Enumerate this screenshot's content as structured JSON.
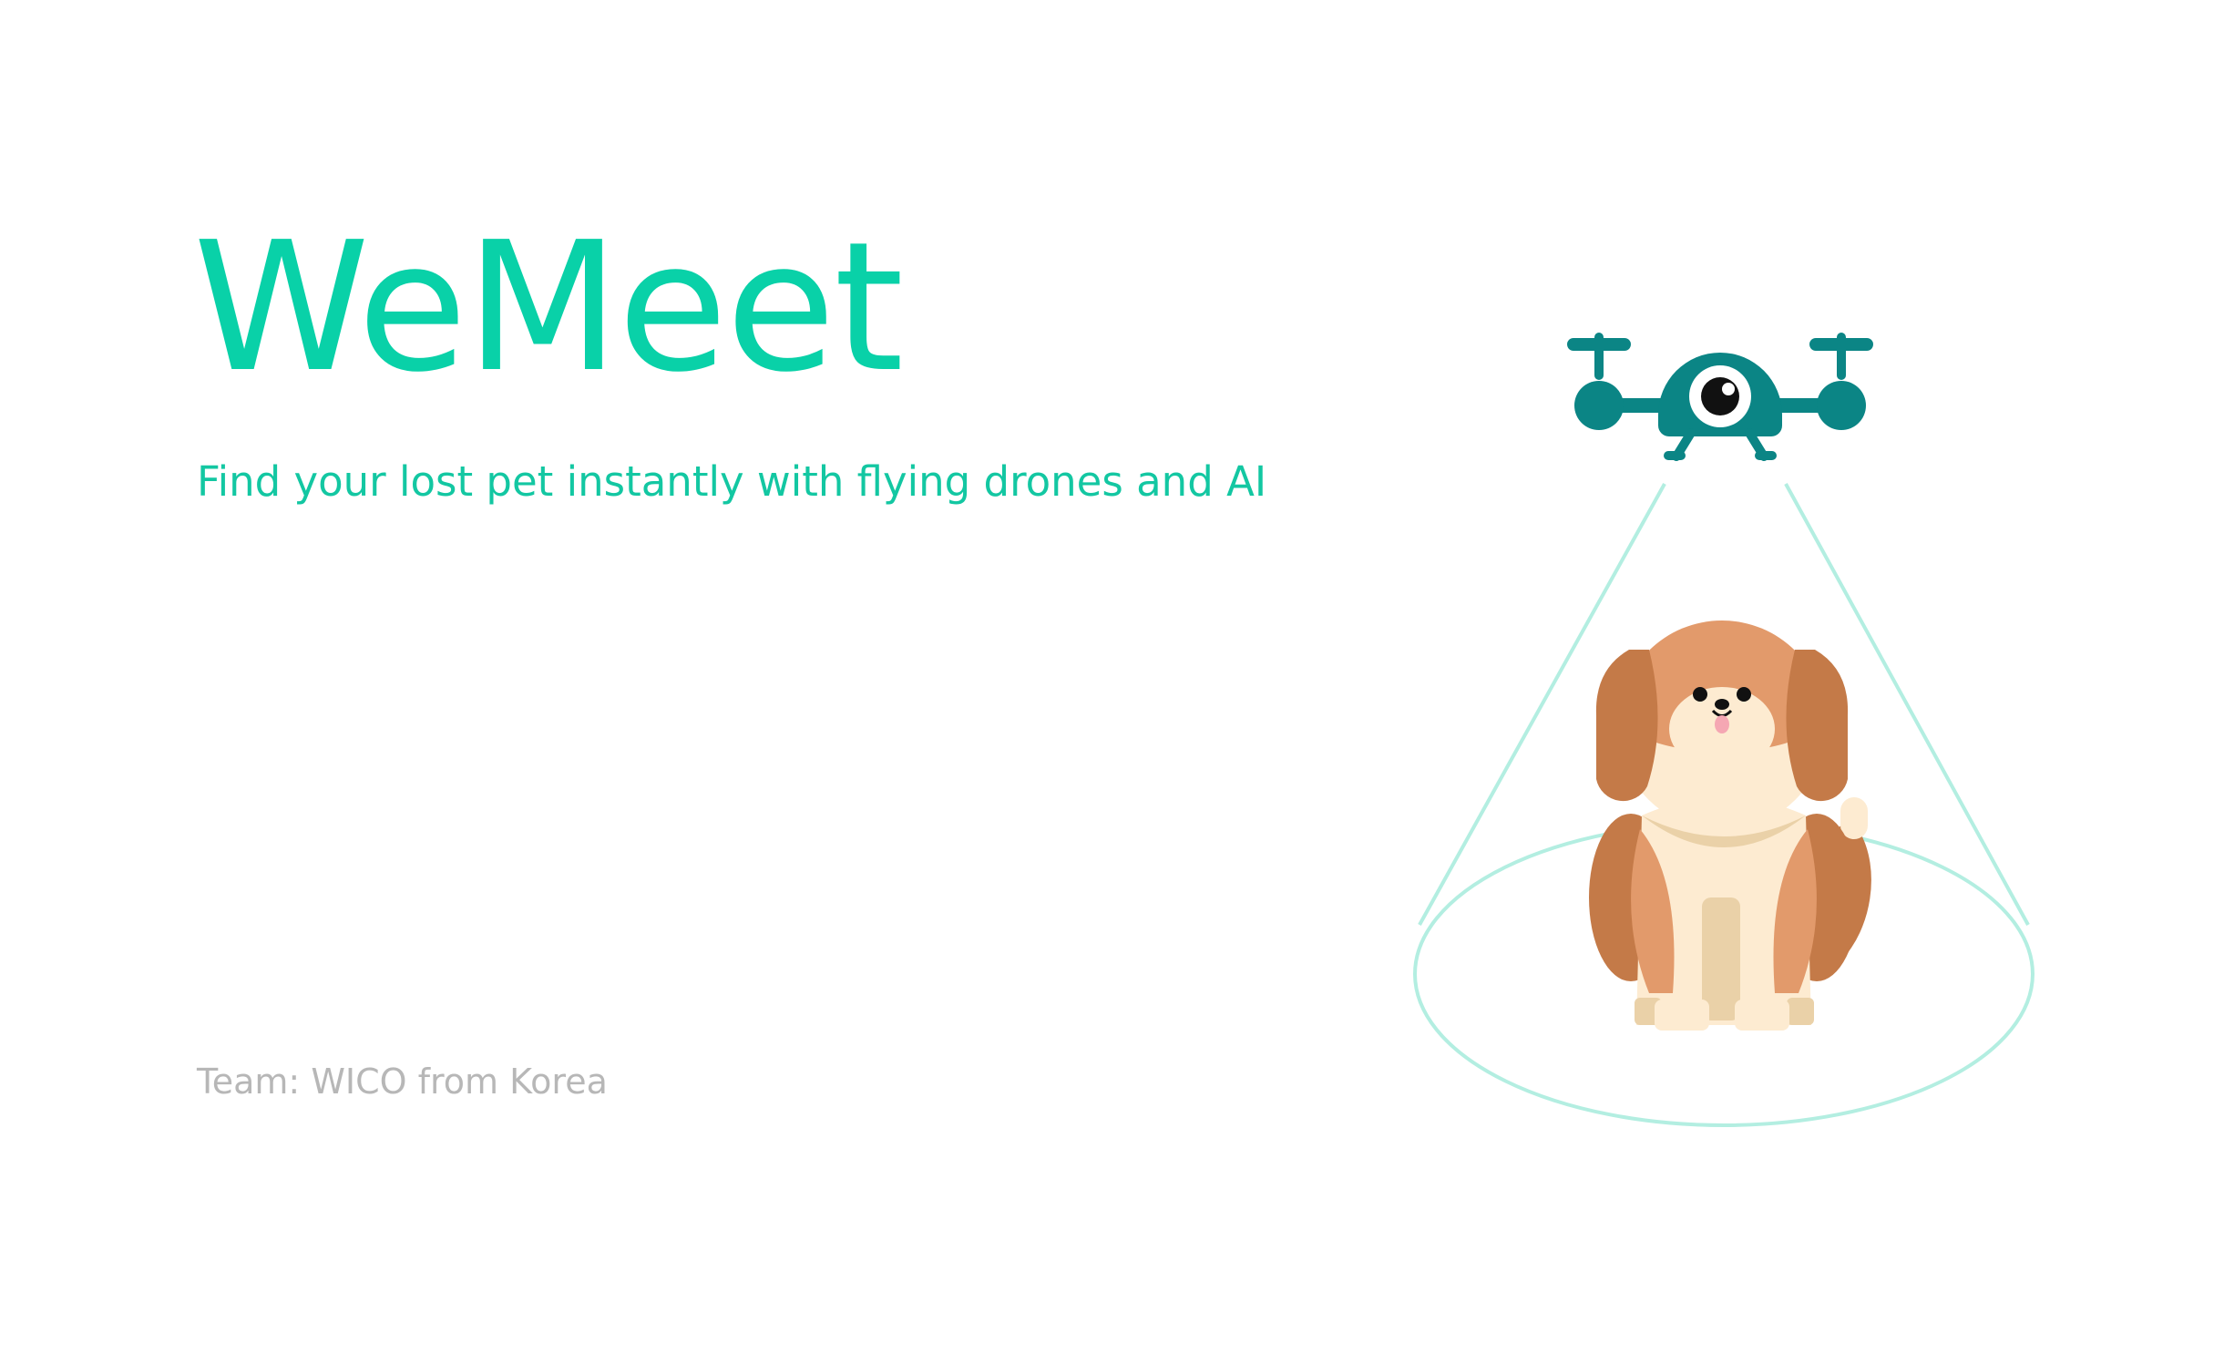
{
  "title": "WeMeet",
  "tagline": "Find your lost pet instantly with flying drones and AI",
  "team": "Team: WICO from Korea",
  "illustration": {
    "icons": [
      "drone-icon",
      "dog-icon"
    ]
  },
  "colors": {
    "brand": "#09d1a8",
    "drone": "#0b8585",
    "beam": "#b3eee1",
    "muted_text": "#b7b7b7"
  }
}
